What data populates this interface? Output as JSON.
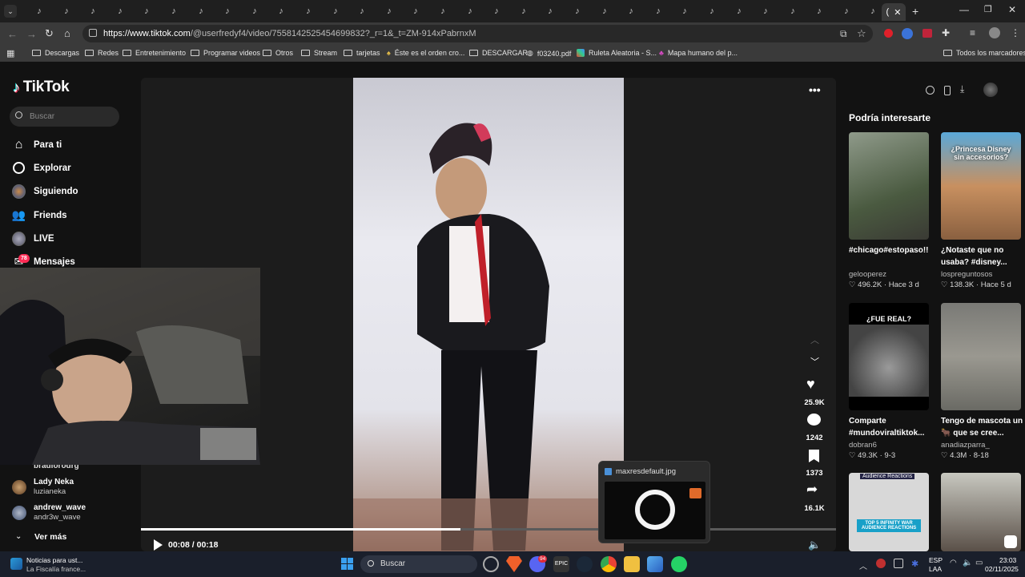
{
  "browser": {
    "tab_icon_glyph": "♪",
    "active_tab_label": "(",
    "url_host": "https://www.tiktok.com",
    "url_path": "/@userfredyf4/video/7558142525454699832?_r=1&_t=ZM-914xPabrnxM",
    "bookmarks": [
      "Descargas",
      "Redes",
      "Entretenimiento",
      "Programar videos",
      "Otros",
      "Stream",
      "tarjetas",
      "Éste es el orden cro...",
      "DESCARGAR",
      "f03240.pdf",
      "Ruleta Aleatoria - S...",
      "Mapa humano del p..."
    ],
    "all_bookmarks": "Todos los marcadores"
  },
  "tiktok": {
    "logo": "TikTok",
    "search_placeholder": "Buscar",
    "nav": {
      "for_you": "Para ti",
      "explore": "Explorar",
      "following": "Siguiendo",
      "friends": "Friends",
      "live": "LIVE",
      "messages": "Mensajes",
      "messages_badge": "78"
    },
    "following_list": [
      {
        "name": "bradlorodrg",
        "handle": ""
      },
      {
        "name": "Lady Neka",
        "handle": "luzianeka"
      },
      {
        "name": "andrew_wave",
        "handle": "andr3w_wave"
      }
    ],
    "see_more": "Ver más",
    "player": {
      "time": "00:08 / 00:18",
      "progress": 0.46,
      "likes": "25.9K",
      "comments": "1242",
      "saves": "1373",
      "shares": "16.1K"
    },
    "recommendations_title": "Podría interesarte",
    "recommendations": [
      {
        "caption": "#chicago#estopaso!!",
        "user": "gelooperez",
        "stat": "496.2K · Hace 3 d"
      },
      {
        "caption": "¿Notaste que no usaba? #disney...",
        "user": "lospreguntosos",
        "stat": "138.3K · Hace 5 d",
        "thumb_text": "¿Princesa Disney sin accesorios?"
      },
      {
        "caption": "Comparte #mundoviraltiktok...",
        "user": "dobran6",
        "stat": "49.3K · 9-3",
        "thumb_text": "¿FUE REAL?"
      },
      {
        "caption": "Tengo de mascota un 🐂 que se cree...",
        "user": "anadiazparra_",
        "stat": "4.3M · 8-18"
      },
      {
        "caption": "",
        "user": "",
        "stat": "",
        "thumb_text": "Audience Reactions",
        "thumb_text2": "TOP 5 INFINITY WAR AUDIENCE REACTIONS"
      }
    ]
  },
  "popup": {
    "filename": "maxresdefault.jpg"
  },
  "taskbar": {
    "news_title": "Noticias para ust...",
    "news_sub": "La Fiscalía france...",
    "search": "Buscar",
    "lang": "ESP",
    "lang_sub": "LAA",
    "time": "23:03",
    "date": "02/11/2025",
    "discord_badge": "94"
  }
}
